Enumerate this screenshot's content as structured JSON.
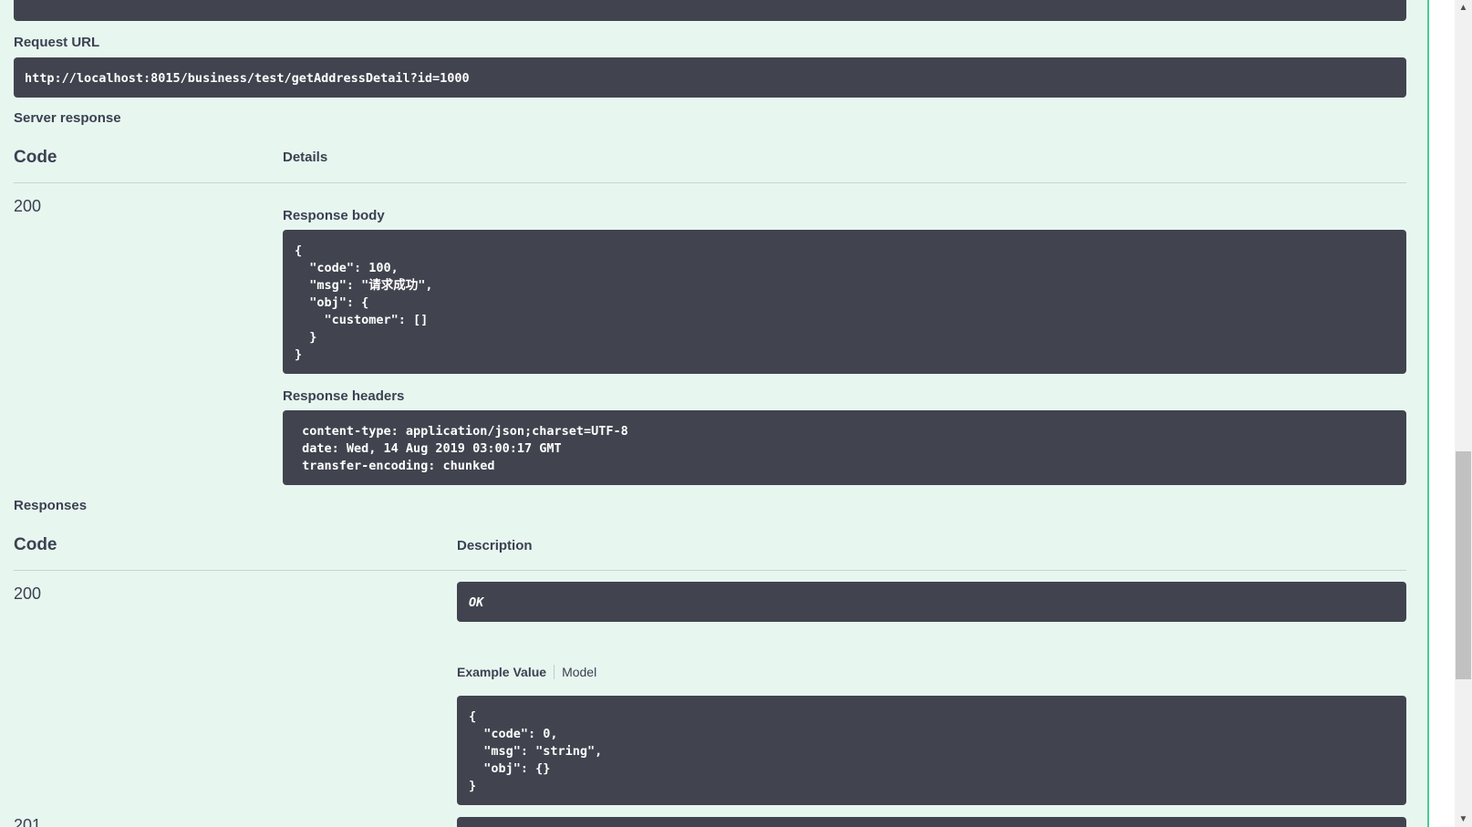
{
  "request_url": {
    "label": "Request URL",
    "value": "http://localhost:8015/business/test/getAddressDetail?id=1000"
  },
  "server_response": {
    "title": "Server response",
    "col_code": "Code",
    "col_details": "Details",
    "status": "200",
    "body_label": "Response body",
    "body": "{\n  \"code\": 100,\n  \"msg\": \"请求成功\",\n  \"obj\": {\n    \"customer\": []\n  }\n}",
    "headers_label": "Response headers",
    "headers": " content-type: application/json;charset=UTF-8\n date: Wed, 14 Aug 2019 03:00:17 GMT\n transfer-encoding: chunked"
  },
  "responses": {
    "title": "Responses",
    "col_code": "Code",
    "col_description": "Description",
    "rows": [
      {
        "code": "200",
        "description": "OK",
        "tab_example": "Example Value",
        "tab_model": "Model",
        "example": "{\n  \"code\": 0,\n  \"msg\": \"string\",\n  \"obj\": {}\n}"
      },
      {
        "code": "201"
      }
    ]
  },
  "colors": {
    "block_bg": "#e8f6f0",
    "block_border": "#49cc90",
    "code_bg": "#41444e",
    "text": "#3b4151"
  },
  "icons": {
    "scroll_up": "chevron-up-icon",
    "scroll_down": "chevron-down-icon"
  }
}
